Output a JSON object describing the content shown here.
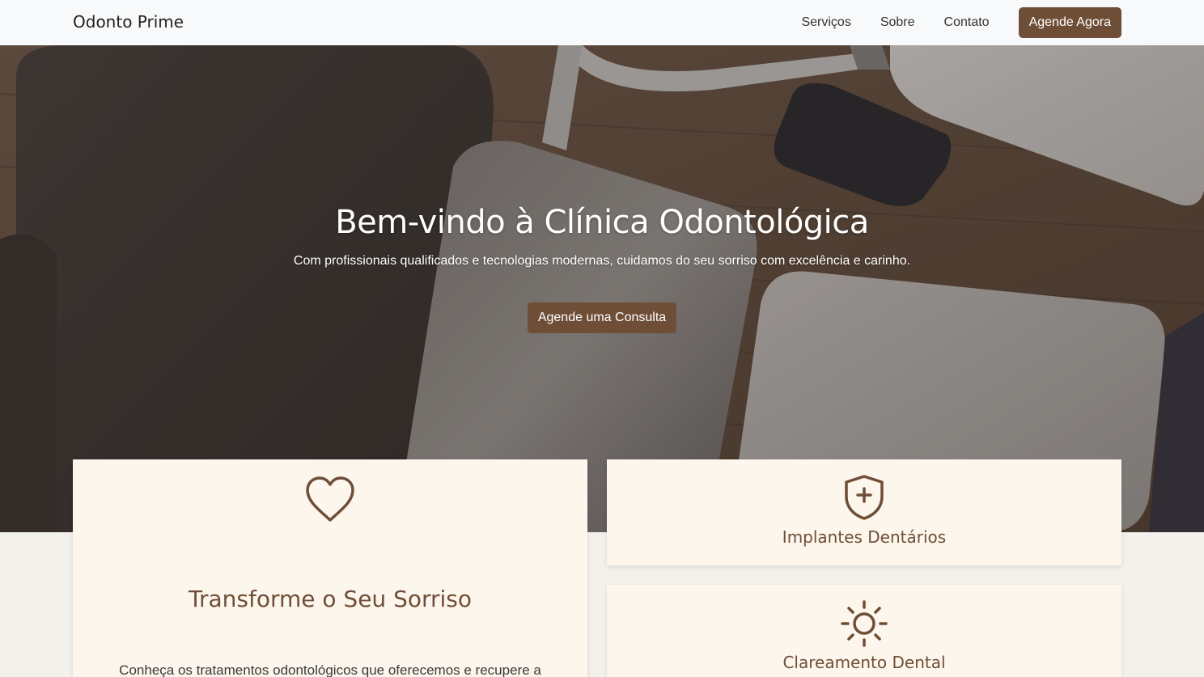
{
  "navbar": {
    "brand": "Odonto Prime",
    "links": [
      "Serviços",
      "Sobre",
      "Contato"
    ],
    "cta": "Agende Agora"
  },
  "hero": {
    "title": "Bem-vindo à Clínica Odontológica",
    "subtitle": "Com profissionais qualificados e tecnologias modernas, cuidamos do seu sorriso com excelência e carinho.",
    "button": "Agende uma Consulta"
  },
  "cards": {
    "main": {
      "icon": "heart-icon",
      "title": "Transforme o Seu Sorriso",
      "text": "Conheça os tratamentos odontológicos que oferecemos e recupere a"
    },
    "implants": {
      "icon": "shield-plus-icon",
      "title": "Implantes Dentários"
    },
    "whitening": {
      "icon": "sun-icon",
      "title": "Clareamento Dental"
    }
  },
  "colors": {
    "accent": "#6f4e37",
    "card_bg": "#fdf6ec",
    "page_bg": "#f3f1eb",
    "navbar_bg": "#f8f9fa"
  }
}
